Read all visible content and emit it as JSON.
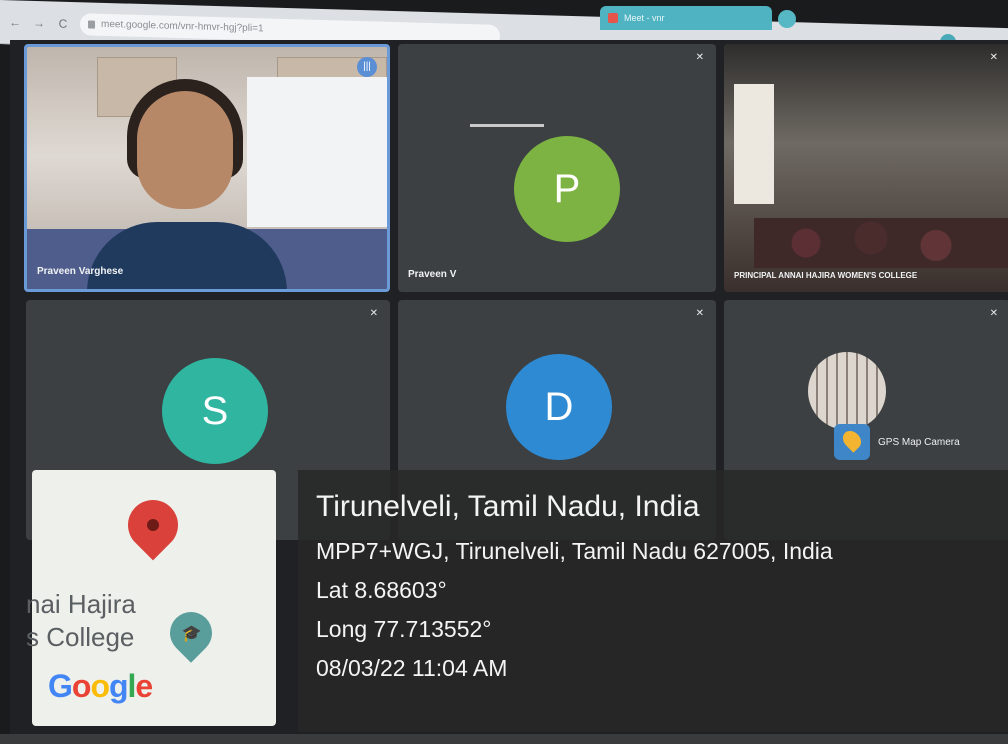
{
  "browser": {
    "url": "meet.google.com/vnr-hmvr-hgj?pli=1",
    "tab_title": "Meet - vnr",
    "back": "←",
    "forward": "→",
    "reload": "C"
  },
  "meeting": {
    "tiles": [
      {
        "kind": "video",
        "name": "Praveen Varghese",
        "speaking": true
      },
      {
        "kind": "avatar",
        "name": "Praveen V",
        "initial": "P",
        "color": "#7cb342"
      },
      {
        "kind": "hall",
        "name": "PRINCIPAL ANNAI HAJIRA WOMEN'S COLLEGE"
      },
      {
        "kind": "avatar",
        "name": "",
        "initial": "S",
        "color": "#2fb5a0"
      },
      {
        "kind": "avatar",
        "name": "",
        "initial": "D",
        "color": "#2e8bd3"
      },
      {
        "kind": "thumb",
        "name": ""
      }
    ]
  },
  "gps_overlay": {
    "app_name": "GPS Map Camera",
    "map": {
      "place_text": "nai Hajira\ns College",
      "logo_letters": [
        "G",
        "o",
        "o",
        "g",
        "l",
        "e"
      ],
      "logo_colors": [
        "#4285f4",
        "#ea4335",
        "#fbbc05",
        "#4285f4",
        "#34a853",
        "#ea4335"
      ]
    },
    "location": "Tirunelveli, Tamil Nadu, India",
    "address": "MPP7+WGJ, Tirunelveli, Tamil Nadu 627005, India",
    "lat": "Lat 8.68603°",
    "long": "Long 77.713552°",
    "datetime": "08/03/22 11:04 AM"
  }
}
